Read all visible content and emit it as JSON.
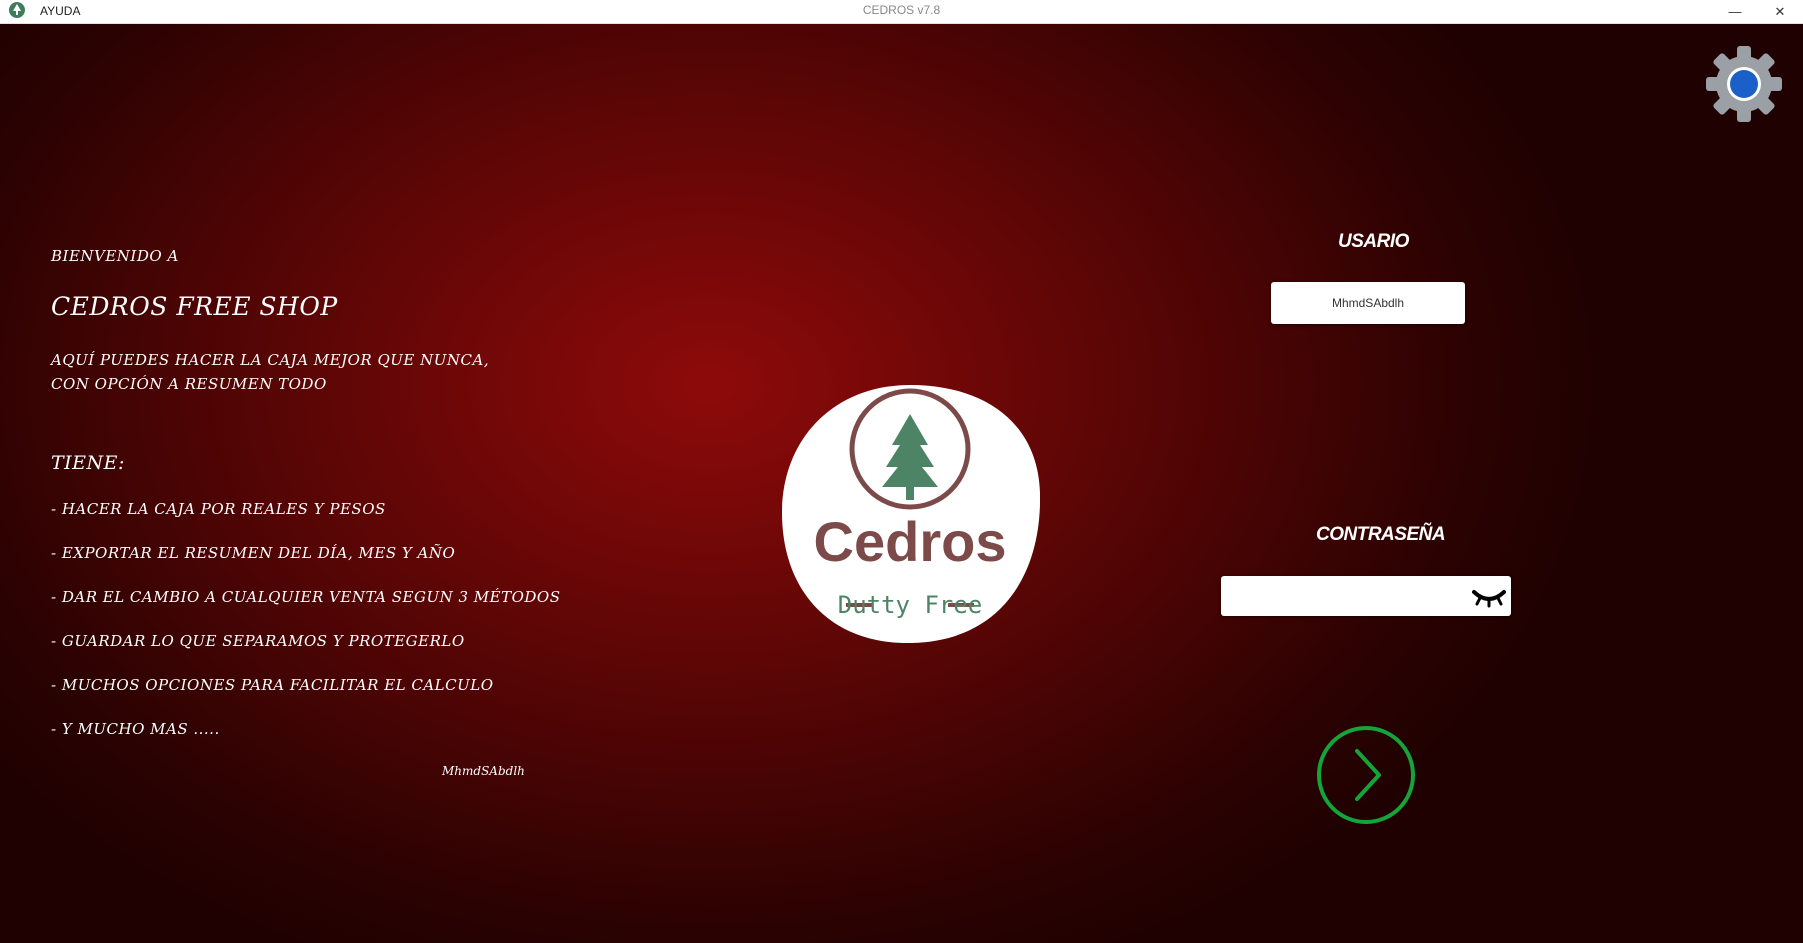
{
  "window": {
    "menu": "AYUDA",
    "title": "CEDROS v7.8",
    "minimize": "—",
    "close": "✕"
  },
  "welcome": {
    "greeting": "BIENVENIDO A",
    "shop_name": "CEDROS FREE SHOP",
    "intro_line1": "AQUÍ PUEDES HACER LA CAJA MEJOR QUE NUNCA,",
    "intro_line2": "CON OPCIÓN A RESUMEN TODO",
    "features_title": "TIENE:",
    "features": [
      "- HACER LA CAJA POR REALES Y PESOS",
      "- EXPORTAR EL RESUMEN DEL DÍA, MES Y AÑO",
      "- DAR EL CAMBIO A CUALQUIER VENTA SEGUN 3 MÉTODOS",
      "- GUARDAR LO QUE SEPARAMOS Y PROTEGERLO",
      "- MUCHOS OPCIONES PARA FACILITAR EL CALCULO",
      "- Y MUCHO MAS ....."
    ],
    "signature": "MhmdSAbdlh"
  },
  "logo": {
    "name": "Cedros",
    "tagline": "Dutty Free"
  },
  "login": {
    "user_label": "USARIO",
    "user_value": "MhmdSAbdlh",
    "password_label": "CONTRASEÑA",
    "password_value": ""
  },
  "icons": {
    "settings": "gear-icon",
    "password_toggle": "closed-eye-icon",
    "submit": "chevron-right-circle-icon"
  },
  "colors": {
    "background": "#8e0a0a",
    "logo_brown": "#7d4a4a",
    "tree_green": "#4e8466",
    "go_green": "#13a538",
    "gear_blue": "#1b5fc9"
  }
}
